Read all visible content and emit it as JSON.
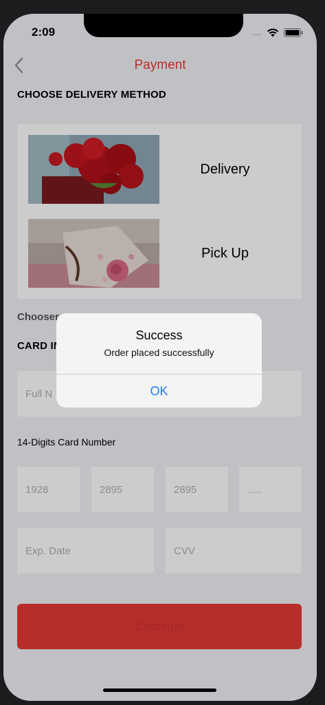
{
  "status": {
    "time": "2:09",
    "signal": "...."
  },
  "header": {
    "title": "Payment"
  },
  "delivery": {
    "heading": "CHOOSE DELIVERY METHOD",
    "options": [
      {
        "label": "Delivery",
        "image": "red-roses-bouquet"
      },
      {
        "label": "Pick Up",
        "image": "wrapped-rose-bouquet"
      }
    ],
    "chosen_text": "Chooser"
  },
  "card": {
    "heading": "CARD IN",
    "full_name_placeholder": "Full N",
    "number_label": "14-Digits Card Number",
    "number_parts": [
      "1928",
      "2895",
      "2895",
      "....."
    ],
    "exp_placeholder": "Exp. Date",
    "cvv_placeholder": "CVV"
  },
  "continue_label": "Continue",
  "alert": {
    "title": "Success",
    "message": "Order placed successfully",
    "ok": "OK"
  },
  "colors": {
    "accent": "#e53935",
    "link": "#1e7cf0"
  }
}
